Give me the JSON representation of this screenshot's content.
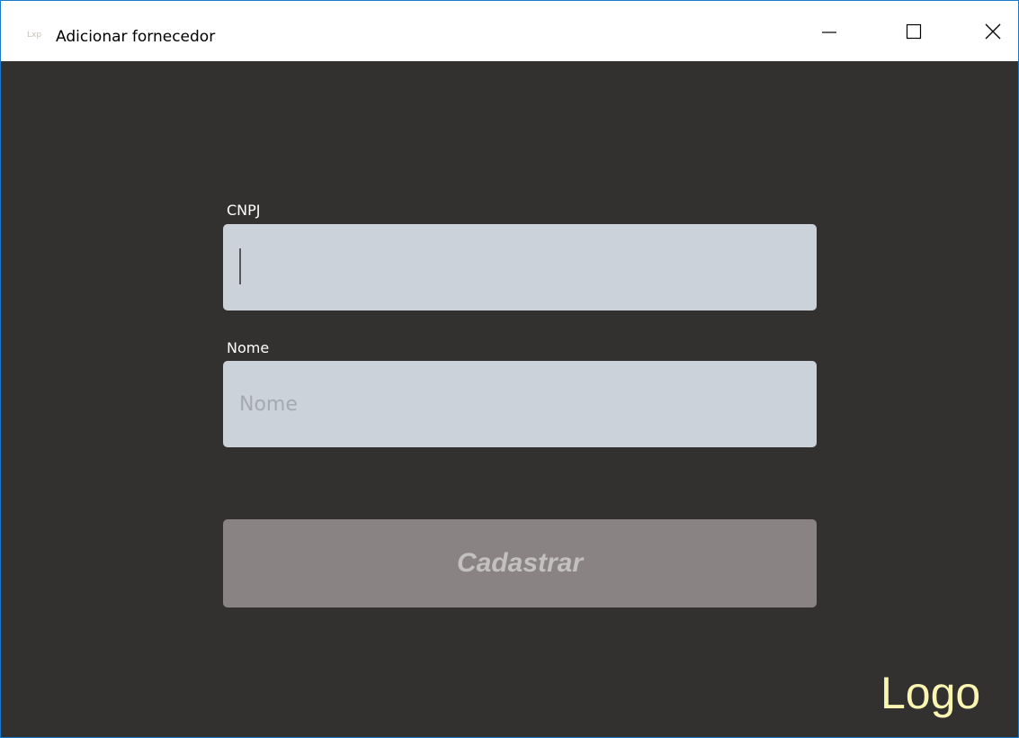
{
  "window": {
    "title": "Adicionar fornecedor",
    "app_icon_text": "Lxp",
    "controls": {
      "minimize_icon": "minimize-icon",
      "maximize_icon": "maximize-icon",
      "close_icon": "close-icon"
    }
  },
  "form": {
    "cnpj": {
      "label": "CNPJ",
      "value": "",
      "placeholder": ""
    },
    "nome": {
      "label": "Nome",
      "value": "",
      "placeholder": "Nome"
    },
    "submit_label": "Cadastrar"
  },
  "logo": {
    "text": "Logo"
  },
  "colors": {
    "background": "#333130",
    "input_background": "#ccd2da",
    "button_background": "#898383",
    "button_text": "#c3c0c0",
    "logo_text": "#faf6b2",
    "window_border": "#1979ca"
  }
}
